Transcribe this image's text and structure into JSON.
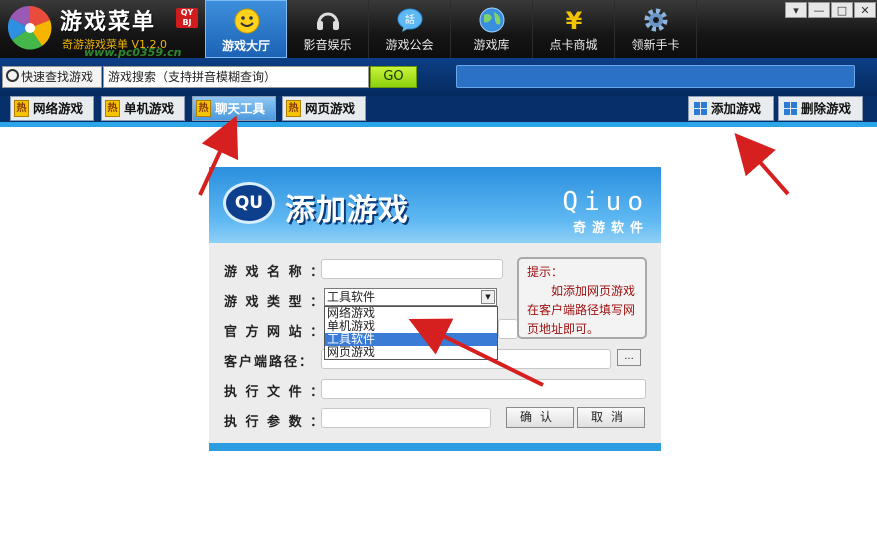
{
  "app": {
    "title": "游戏菜单",
    "badge": "QY BJ",
    "subtitle": "奇游游戏菜单 V1.2.0",
    "watermark": "www.pc0359.cn"
  },
  "window_controls": {
    "minimize": "▾",
    "restore": "—",
    "maximize": "□",
    "close": "✕"
  },
  "nav": [
    {
      "label": "游戏大厅",
      "icon": "smiley-icon",
      "active": true
    },
    {
      "label": "影音娱乐",
      "icon": "headphones-icon"
    },
    {
      "label": "游戏公会",
      "icon": "chat-bubble-icon"
    },
    {
      "label": "游戏库",
      "icon": "globe-icon"
    },
    {
      "label": "点卡商城",
      "icon": "yen-icon"
    },
    {
      "label": "领新手卡",
      "icon": "gear-icon"
    }
  ],
  "search": {
    "quick_label": "快速查找游戏",
    "value": "游戏搜索（支持拼音模糊查询）",
    "go": "GO"
  },
  "categories": [
    {
      "label": "网络游戏",
      "icon": "热"
    },
    {
      "label": "单机游戏",
      "icon": "热"
    },
    {
      "label": "聊天工具",
      "icon": "热",
      "active": true
    },
    {
      "label": "网页游戏",
      "icon": "热"
    }
  ],
  "actions": {
    "add": "添加游戏",
    "delete": "删除游戏"
  },
  "dialog": {
    "logo_text": "QU",
    "title": "添加游戏",
    "brand": "Qiuo",
    "brand_sub": "奇游软件",
    "fields": {
      "name": "游 戏 名 称 ：",
      "type": "游 戏 类 型 ：",
      "website": "官 方 网 站 ：",
      "client_path": "客户端路径：",
      "exe": "执 行 文 件 ：",
      "params": "执 行 参 数 ："
    },
    "type_selected": "工具软件",
    "type_options": [
      "网络游戏",
      "单机游戏",
      "工具软件",
      "网页游戏"
    ],
    "tip_title": "提示：",
    "tip_text": "如添加网页游戏在客户端路径填写网页地址即可。",
    "browse": "...",
    "ok": "确认",
    "cancel": "取消"
  },
  "colors": {
    "header_dark": "#151515",
    "active_tab": "#2a7ccf",
    "search_bar": "#0c3f86",
    "go_green": "#8bd10d",
    "dialog_blue": "#2a8fde",
    "tip_red": "#a01010",
    "arrow_red": "#d61f1f"
  }
}
